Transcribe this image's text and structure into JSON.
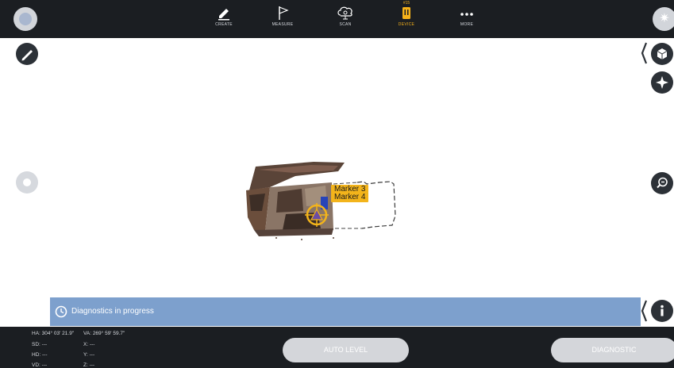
{
  "toolbar": {
    "tools": [
      {
        "label": "CREATE",
        "icon": "pen-icon"
      },
      {
        "label": "MEASURE",
        "icon": "flag-icon"
      },
      {
        "label": "SCAN",
        "icon": "cloud-scan-icon"
      },
      {
        "label": "DEVICE",
        "icon": "device-icon",
        "badge": "#15",
        "active": true
      },
      {
        "label": "MORE",
        "icon": "more-dots-icon"
      }
    ],
    "accent_color": "#f6b21a"
  },
  "viewport": {
    "markers": [
      {
        "label": "Marker 3"
      },
      {
        "label": "Marker 4"
      }
    ],
    "marker_color": "#f3b41b"
  },
  "status": {
    "text": "Diagnostics in progress",
    "color": "#7da0cd"
  },
  "readouts": {
    "ha_label": "HA:",
    "ha_value": "304° 03' 21.9\"",
    "va_label": "VA:",
    "va_value": "269° 59' 59.7\"",
    "sd_label": "SD:",
    "sd_value": "---",
    "hd_label": "HD:",
    "hd_value": "---",
    "vd_label": "VD:",
    "vd_value": "---",
    "x_label": "X:",
    "x_value": "---",
    "y_label": "Y:",
    "y_value": "---",
    "z_label": "Z:",
    "z_value": "---"
  },
  "actions": {
    "auto_level_label": "AUTO LEVEL",
    "diagnostic_label": "DIAGNOSTIC"
  }
}
